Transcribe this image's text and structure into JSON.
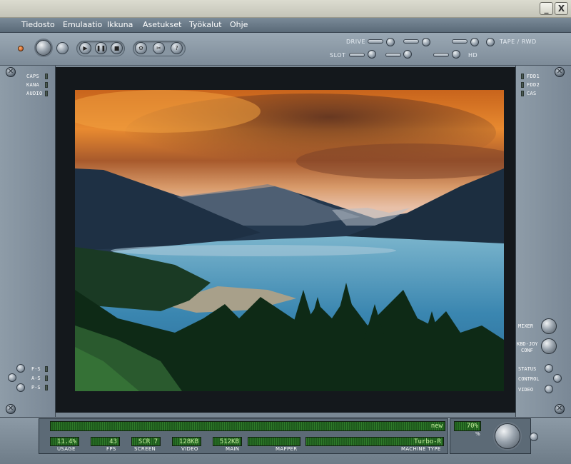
{
  "window": {
    "minimize": "_",
    "close": "X"
  },
  "menu": [
    "Tiedosto",
    "Emulaatio",
    "Ikkuna",
    "Asetukset",
    "Työkalut",
    "Ohje"
  ],
  "toolbar": {
    "drive_label": "DRIVE",
    "slot_label": "SLOT",
    "tape_label": "TAPE / RWD",
    "hd_label": "HD"
  },
  "left_panel": {
    "indicators": [
      "CAPS",
      "KANA",
      "AUDIO"
    ],
    "bottom_labels": [
      "F-S",
      "A-S",
      "P-S"
    ]
  },
  "right_panel": {
    "indicators": [
      "FDD1",
      "FDD2",
      "CAS"
    ],
    "mixer": "MIXER",
    "kbd_joy": "KBD-JOY",
    "kbd_conf": "CONF",
    "status": "STATUS",
    "control": "CONTROL",
    "video": "VIDEO"
  },
  "status_bar": {
    "top_lcd": "new",
    "usage": {
      "value": "11.4%",
      "label": "USAGE"
    },
    "fps": {
      "value": "43",
      "label": "FPS"
    },
    "screen": {
      "value": "SCR 7",
      "label": "SCREEN"
    },
    "video": {
      "value": "128KB",
      "label": "VIDEO"
    },
    "main": {
      "value": "512KB",
      "label": "MAIN"
    },
    "mapper": {
      "value": "",
      "label": "MAPPER"
    },
    "machine": {
      "value": "Turbo-R",
      "label": "MACHINE TYPE"
    },
    "volume": {
      "value": "70%",
      "label": "%"
    }
  },
  "colors": {
    "lcd_bg": "#1e5a1c",
    "lcd_text": "#c8f0a0",
    "panel": "#7a8896"
  }
}
